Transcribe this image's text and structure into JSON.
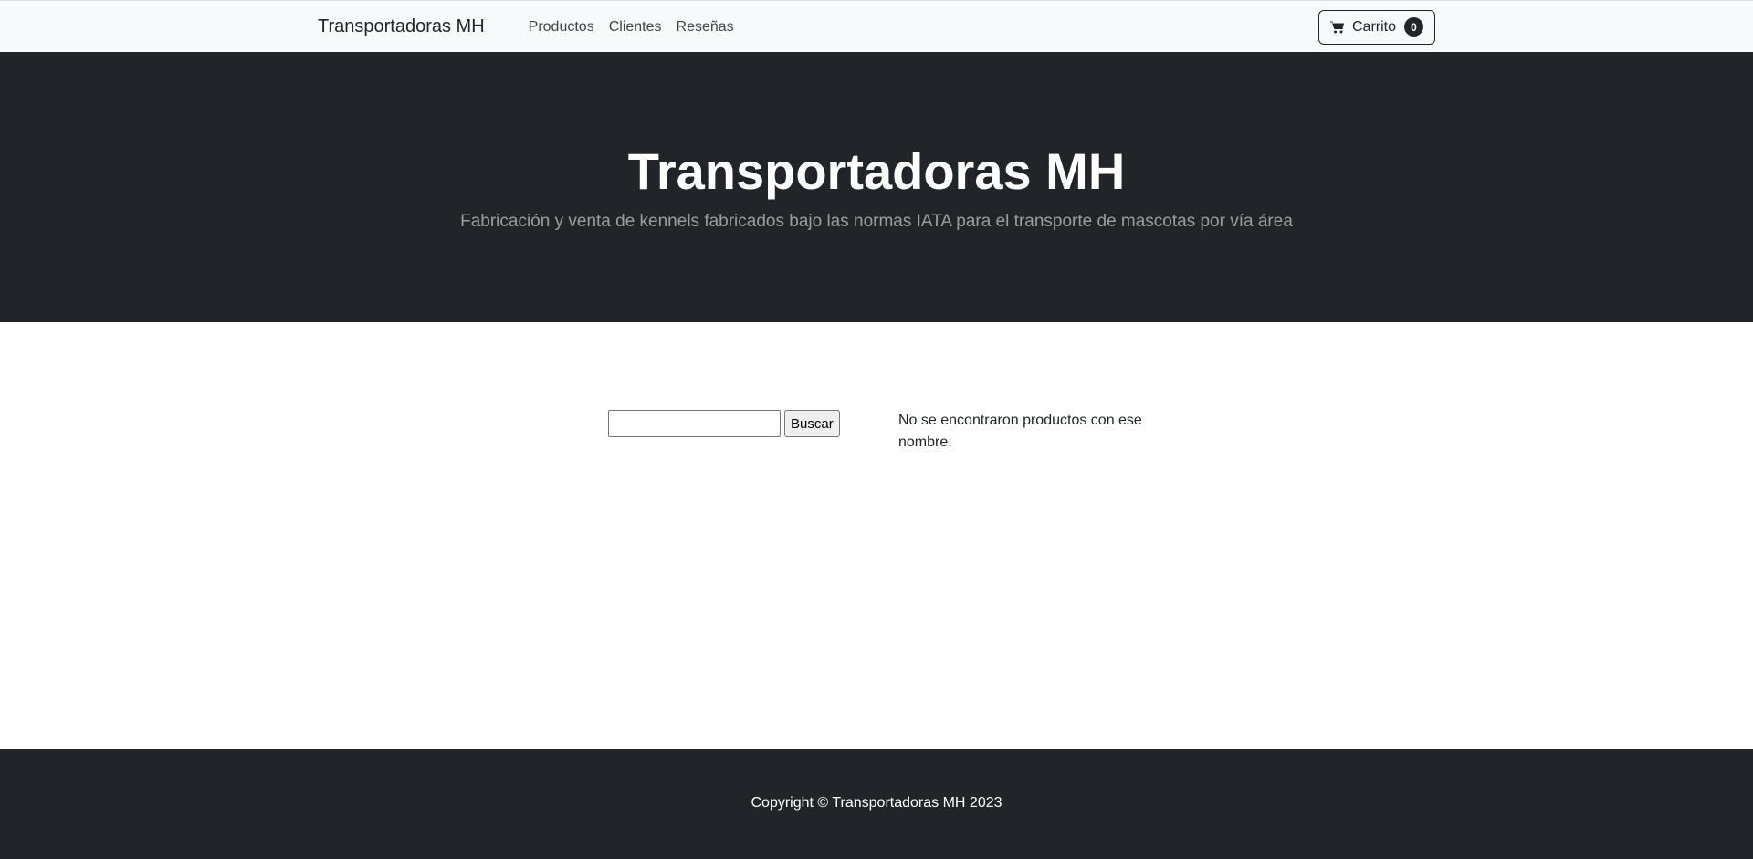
{
  "navbar": {
    "brand": "Transportadoras MH",
    "links": [
      "Productos",
      "Clientes",
      "Reseñas"
    ],
    "cart": {
      "label": "Carrito",
      "count": "0",
      "icon": "cart-icon"
    }
  },
  "hero": {
    "title": "Transportadoras MH",
    "subtitle": "Fabricación y venta de kennels fabricados bajo las normas IATA para el transporte de mascotas por vía área"
  },
  "search": {
    "value": "",
    "button_label": "Buscar",
    "message": "No se encontraron productos con ese nombre."
  },
  "footer": {
    "copyright": "Copyright © Transportadoras MH 2023"
  },
  "colors": {
    "dark": "#212529",
    "light": "#f8f9fa",
    "muted_text": "rgba(255,255,255,.55)"
  }
}
